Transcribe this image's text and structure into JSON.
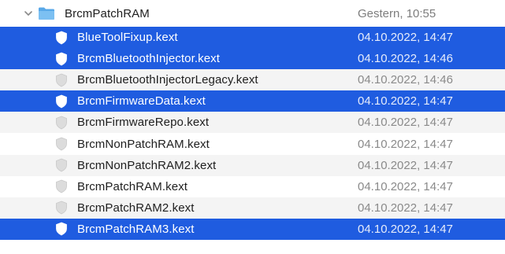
{
  "folder": {
    "name": "BrcmPatchRAM",
    "date": "Gestern, 10:55",
    "icon": "folder-icon",
    "expanded_icon": "chevron-down-icon"
  },
  "colors": {
    "selection": "#1f5ce0",
    "folder_blue": "#58a8e8",
    "alt_row": "#f4f4f4"
  },
  "items": [
    {
      "name": "BlueToolFixup.kext",
      "date": "04.10.2022, 14:47",
      "selected": true
    },
    {
      "name": "BrcmBluetoothInjector.kext",
      "date": "04.10.2022, 14:46",
      "selected": true
    },
    {
      "name": "BrcmBluetoothInjectorLegacy.kext",
      "date": "04.10.2022, 14:46",
      "selected": false
    },
    {
      "name": "BrcmFirmwareData.kext",
      "date": "04.10.2022, 14:47",
      "selected": true
    },
    {
      "name": "BrcmFirmwareRepo.kext",
      "date": "04.10.2022, 14:47",
      "selected": false
    },
    {
      "name": "BrcmNonPatchRAM.kext",
      "date": "04.10.2022, 14:47",
      "selected": false
    },
    {
      "name": "BrcmNonPatchRAM2.kext",
      "date": "04.10.2022, 14:47",
      "selected": false
    },
    {
      "name": "BrcmPatchRAM.kext",
      "date": "04.10.2022, 14:47",
      "selected": false
    },
    {
      "name": "BrcmPatchRAM2.kext",
      "date": "04.10.2022, 14:47",
      "selected": false
    },
    {
      "name": "BrcmPatchRAM3.kext",
      "date": "04.10.2022, 14:47",
      "selected": true
    }
  ]
}
